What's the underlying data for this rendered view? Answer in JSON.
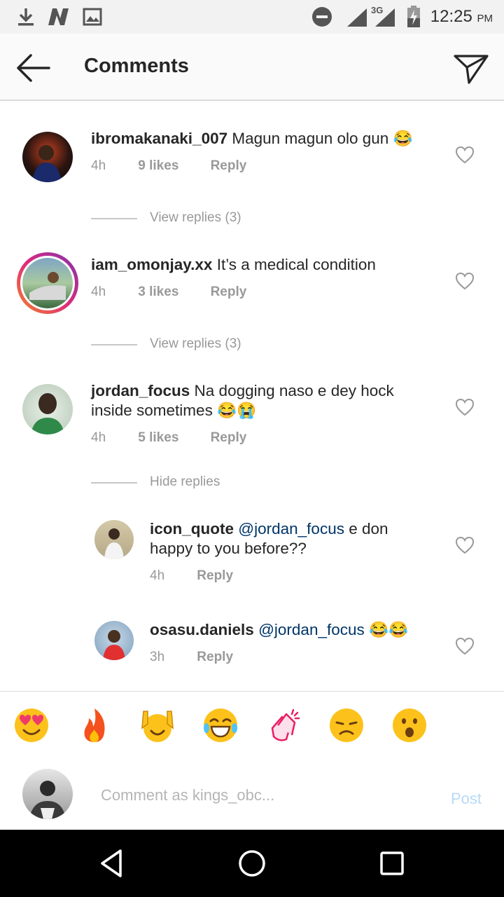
{
  "status_bar": {
    "time": "12:25",
    "ampm": "PM",
    "network": "3G"
  },
  "header": {
    "title": "Comments"
  },
  "comments": [
    {
      "username": "ibromakanaki_007",
      "text": "Magun magun olo gun 😂",
      "age": "4h",
      "likes": "9 likes",
      "reply_label": "Reply",
      "replies_toggle": "View replies (3)"
    },
    {
      "username": "iam_omonjay.xx",
      "text": "It’s a medical condition",
      "age": "4h",
      "likes": "3 likes",
      "reply_label": "Reply",
      "replies_toggle": "View replies (3)"
    },
    {
      "username": "jordan_focus",
      "text_line1": "Na dogging naso e dey hock",
      "text_line2": "inside sometimes 😂😭",
      "age": "4h",
      "likes": "5 likes",
      "reply_label": "Reply",
      "replies_toggle": "Hide replies"
    }
  ],
  "replies": [
    {
      "username": "icon_quote",
      "mention": "@jordan_focus",
      "text_line1": " e don",
      "text_line2": "happy to you before??",
      "age": "4h",
      "reply_label": "Reply"
    },
    {
      "username": "osasu.daniels",
      "mention": "@jordan_focus",
      "text": " 😂😂",
      "age": "3h",
      "reply_label": "Reply"
    }
  ],
  "emoji_bar": [
    "heart-eyes",
    "fire",
    "raised-hands",
    "tears-of-joy",
    "clapping-hands",
    "sad",
    "surprised"
  ],
  "comment_input": {
    "placeholder": "Comment as kings_obc...",
    "post_label": "Post"
  },
  "colors": {
    "accent": "#003569",
    "post_disabled": "#b7d9f8",
    "meta": "#999999"
  }
}
